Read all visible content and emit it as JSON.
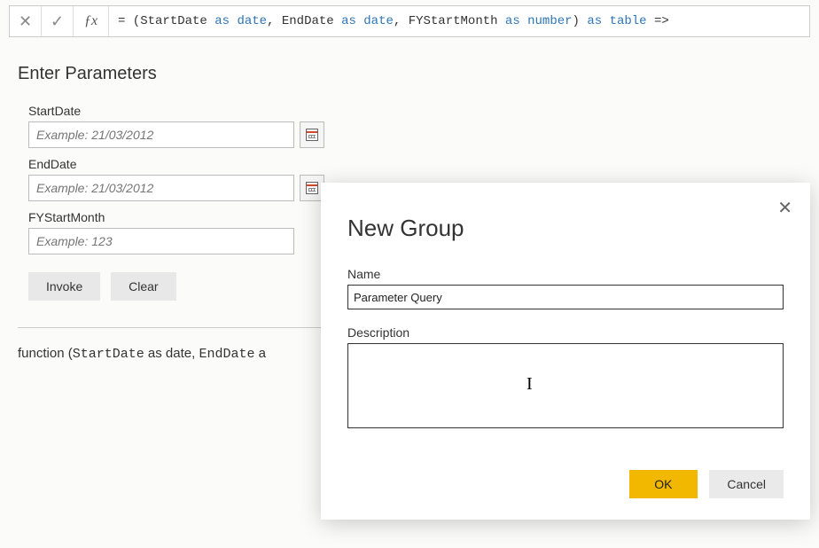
{
  "formula_bar": {
    "prefix": "= (",
    "p1": "StartDate ",
    "p1_kw": "as date",
    "sep1": ", ",
    "p2": "EndDate ",
    "p2_kw": "as date",
    "sep2": ", ",
    "p3": "FYStartMonth ",
    "p3_kw": "as number",
    "close": ") ",
    "ret_kw": "as table",
    "arrow": " =>"
  },
  "section_title": "Enter Parameters",
  "params": {
    "start": {
      "label": "StartDate",
      "placeholder": "Example: 21/03/2012"
    },
    "end": {
      "label": "EndDate",
      "placeholder": "Example: 21/03/2012"
    },
    "fystart": {
      "label": "FYStartMonth",
      "placeholder": "Example: 123"
    }
  },
  "buttons": {
    "invoke": "Invoke",
    "clear": "Clear"
  },
  "function_preview": {
    "t1": "function (",
    "t2": "StartDate",
    "t3": " as date, ",
    "t4": "EndDate",
    "t5": " a"
  },
  "dialog": {
    "title": "New Group",
    "name_label": "Name",
    "name_value": "Parameter Query",
    "desc_label": "Description",
    "ok": "OK",
    "cancel": "Cancel"
  }
}
